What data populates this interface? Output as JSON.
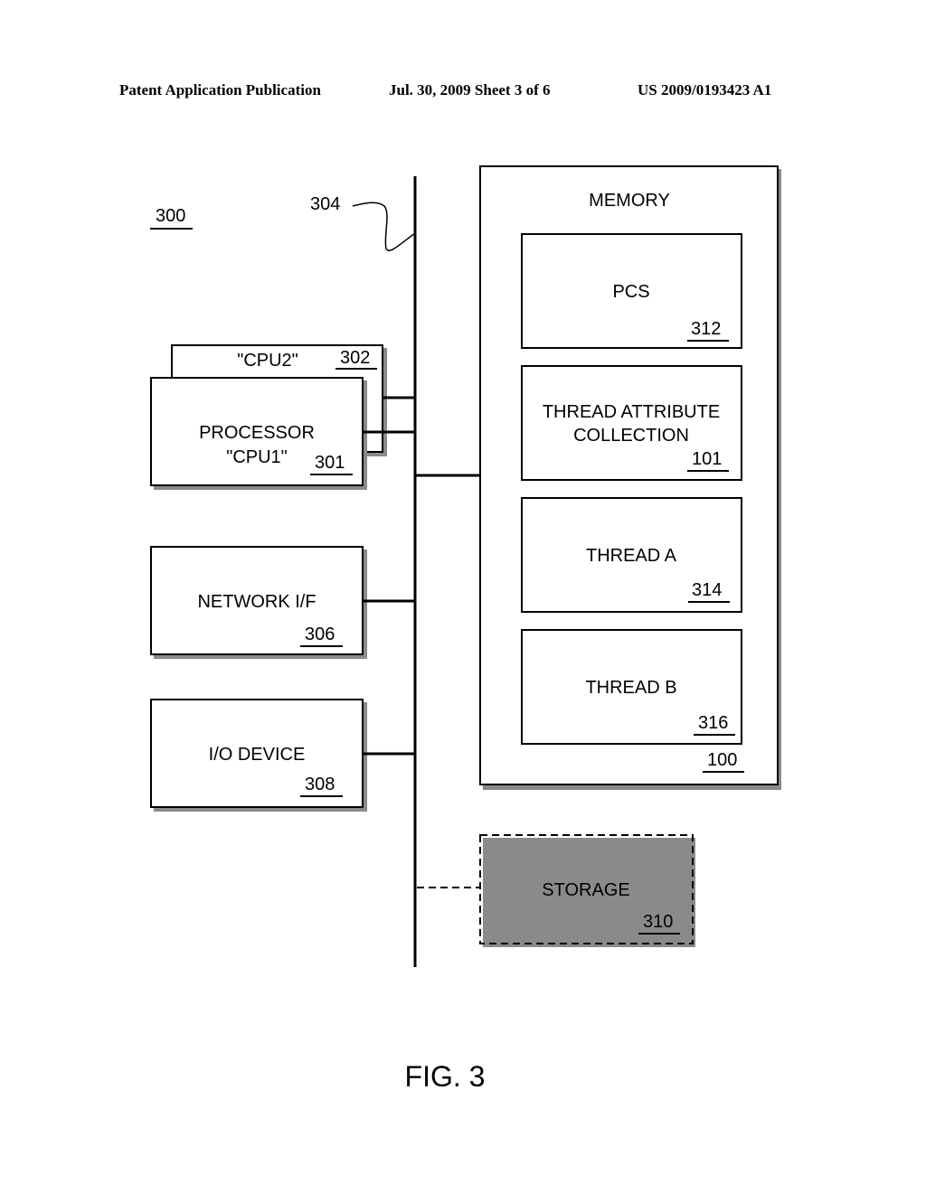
{
  "header": {
    "publication": "Patent Application Publication",
    "date_sheet": "Jul. 30, 2009   Sheet 3 of 6",
    "patent_number": "US 2009/0193423 A1"
  },
  "diagram": {
    "system_ref": "300",
    "bus_ref": "304",
    "cpu2": {
      "label": "\"CPU2\"",
      "ref": "302"
    },
    "cpu1": {
      "line1": "PROCESSOR",
      "line2": "\"CPU1\"",
      "ref": "301"
    },
    "network": {
      "label": "NETWORK I/F",
      "ref": "306"
    },
    "io": {
      "label": "I/O DEVICE",
      "ref": "308"
    },
    "memory": {
      "title": "MEMORY",
      "ref": "100",
      "items": [
        {
          "line1": "PCS",
          "line2": "",
          "ref": "312"
        },
        {
          "line1": "THREAD ATTRIBUTE",
          "line2": "COLLECTION",
          "ref": "101"
        },
        {
          "line1": "THREAD A",
          "line2": "",
          "ref": "314"
        },
        {
          "line1": "THREAD B",
          "line2": "",
          "ref": "316"
        }
      ]
    },
    "storage": {
      "label": "STORAGE",
      "ref": "310"
    }
  },
  "figure_label": "FIG. 3"
}
